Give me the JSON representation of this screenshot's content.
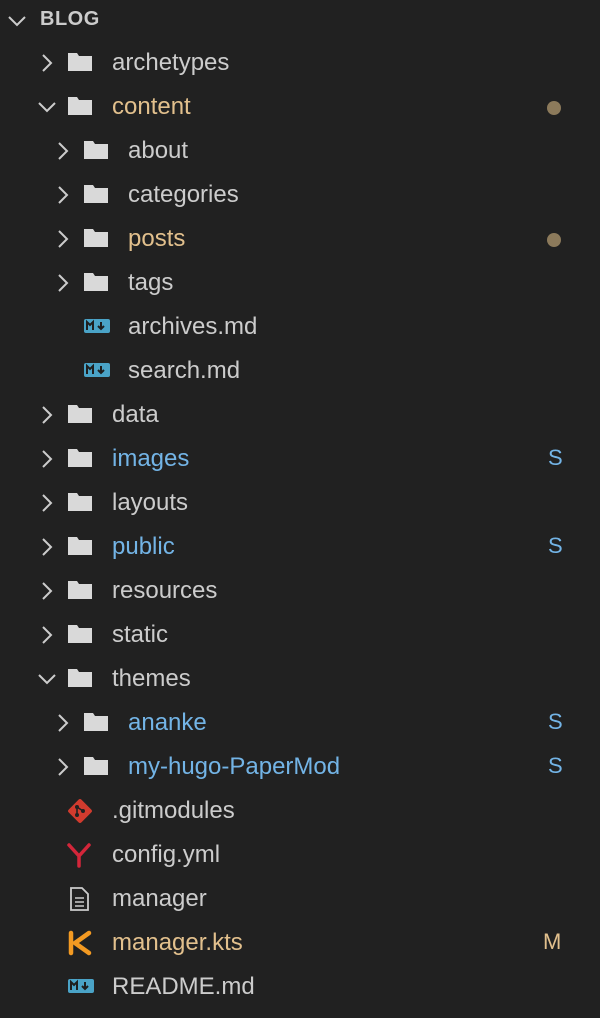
{
  "explorer": {
    "section_title": "BLOG",
    "colors": {
      "background": "#212121",
      "text": "#cccccc",
      "modified": "#e2c08d",
      "submodule": "#73b4e6",
      "dot": "#8c7a5b"
    },
    "items": {
      "archetypes": {
        "label": "archetypes",
        "icon": "folder-icon",
        "state": "collapsed"
      },
      "content": {
        "label": "content",
        "icon": "folder-icon",
        "state": "expanded",
        "decoration": "modified-dot"
      },
      "about": {
        "label": "about",
        "icon": "folder-icon",
        "state": "collapsed"
      },
      "categories": {
        "label": "categories",
        "icon": "folder-icon",
        "state": "collapsed"
      },
      "posts": {
        "label": "posts",
        "icon": "folder-icon",
        "state": "collapsed",
        "decoration": "modified-dot"
      },
      "tags": {
        "label": "tags",
        "icon": "folder-icon",
        "state": "collapsed"
      },
      "archives_md": {
        "label": "archives.md",
        "icon": "markdown-icon"
      },
      "search_md": {
        "label": "search.md",
        "icon": "markdown-icon"
      },
      "data": {
        "label": "data",
        "icon": "folder-icon",
        "state": "collapsed"
      },
      "images": {
        "label": "images",
        "icon": "folder-icon",
        "state": "collapsed",
        "badge": "S"
      },
      "layouts": {
        "label": "layouts",
        "icon": "folder-icon",
        "state": "collapsed"
      },
      "public": {
        "label": "public",
        "icon": "folder-icon",
        "state": "collapsed",
        "badge": "S"
      },
      "resources": {
        "label": "resources",
        "icon": "folder-icon",
        "state": "collapsed"
      },
      "static": {
        "label": "static",
        "icon": "folder-icon",
        "state": "collapsed"
      },
      "themes": {
        "label": "themes",
        "icon": "folder-icon",
        "state": "expanded"
      },
      "ananke": {
        "label": "ananke",
        "icon": "folder-icon",
        "state": "collapsed",
        "badge": "S"
      },
      "my_hugo_papermod": {
        "label": "my-hugo-PaperMod",
        "icon": "folder-icon",
        "state": "collapsed",
        "badge": "S"
      },
      "gitmodules": {
        "label": ".gitmodules",
        "icon": "git-icon"
      },
      "config_yml": {
        "label": "config.yml",
        "icon": "yaml-icon"
      },
      "manager": {
        "label": "manager",
        "icon": "file-icon"
      },
      "manager_kts": {
        "label": "manager.kts",
        "icon": "kotlin-icon",
        "badge": "M"
      },
      "readme_md": {
        "label": "README.md",
        "icon": "markdown-icon"
      }
    }
  }
}
